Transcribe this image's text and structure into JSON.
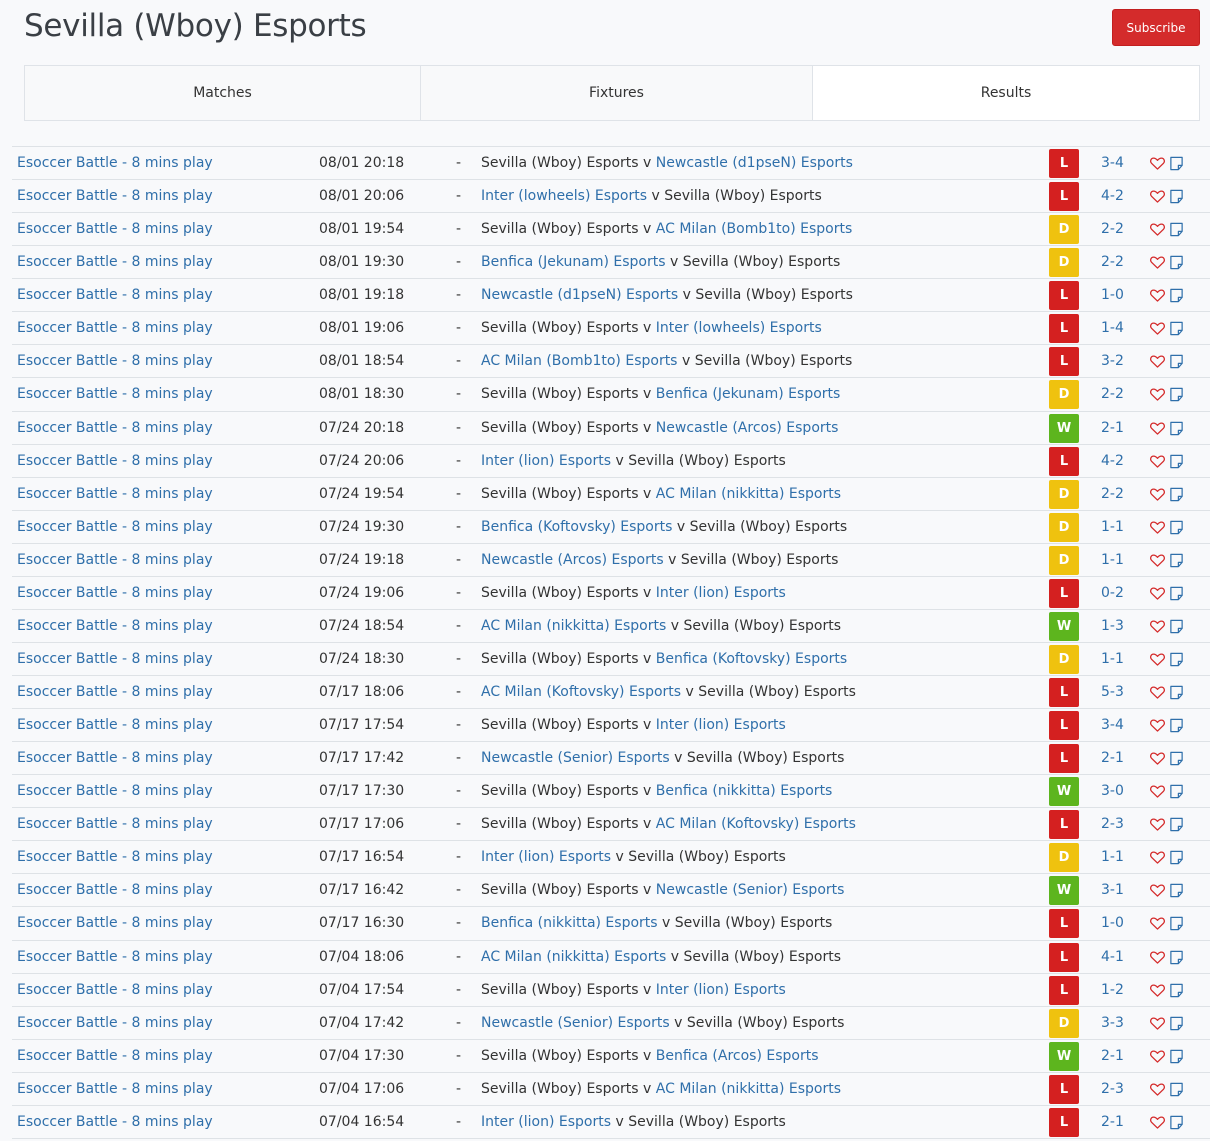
{
  "header": {
    "title": "Sevilla (Wboy) Esports",
    "subscribe_label": "Subscribe"
  },
  "tabs": [
    {
      "label": "Matches",
      "active": false
    },
    {
      "label": "Fixtures",
      "active": false
    },
    {
      "label": "Results",
      "active": true
    }
  ],
  "colors": {
    "loss": "#d42020",
    "draw": "#efc20f",
    "win": "#5db51e",
    "link": "#2f6faa",
    "accent": "#d42b2b"
  },
  "icons": {
    "favourite": "heart-outline-icon",
    "note": "note-edit-icon"
  },
  "results": [
    {
      "league": "Esoccer Battle - 8 mins play",
      "time": "08/01 20:18",
      "dash": "-",
      "home": "Sevilla (Wboy) Esports",
      "sep": "v",
      "away": "Newcastle (d1pseN) Esports",
      "home_link": false,
      "away_link": true,
      "result": "L",
      "score": "3-4"
    },
    {
      "league": "Esoccer Battle - 8 mins play",
      "time": "08/01 20:06",
      "dash": "-",
      "home": "Inter (lowheels) Esports",
      "sep": "v",
      "away": "Sevilla (Wboy) Esports",
      "home_link": true,
      "away_link": false,
      "result": "L",
      "score": "4-2"
    },
    {
      "league": "Esoccer Battle - 8 mins play",
      "time": "08/01 19:54",
      "dash": "-",
      "home": "Sevilla (Wboy) Esports",
      "sep": "v",
      "away": "AC Milan (Bomb1to) Esports",
      "home_link": false,
      "away_link": true,
      "result": "D",
      "score": "2-2"
    },
    {
      "league": "Esoccer Battle - 8 mins play",
      "time": "08/01 19:30",
      "dash": "-",
      "home": "Benfica (Jekunam) Esports",
      "sep": "v",
      "away": "Sevilla (Wboy) Esports",
      "home_link": true,
      "away_link": false,
      "result": "D",
      "score": "2-2"
    },
    {
      "league": "Esoccer Battle - 8 mins play",
      "time": "08/01 19:18",
      "dash": "-",
      "home": "Newcastle (d1pseN) Esports",
      "sep": "v",
      "away": "Sevilla (Wboy) Esports",
      "home_link": true,
      "away_link": false,
      "result": "L",
      "score": "1-0"
    },
    {
      "league": "Esoccer Battle - 8 mins play",
      "time": "08/01 19:06",
      "dash": "-",
      "home": "Sevilla (Wboy) Esports",
      "sep": "v",
      "away": "Inter (lowheels) Esports",
      "home_link": false,
      "away_link": true,
      "result": "L",
      "score": "1-4"
    },
    {
      "league": "Esoccer Battle - 8 mins play",
      "time": "08/01 18:54",
      "dash": "-",
      "home": "AC Milan (Bomb1to) Esports",
      "sep": "v",
      "away": "Sevilla (Wboy) Esports",
      "home_link": true,
      "away_link": false,
      "result": "L",
      "score": "3-2"
    },
    {
      "league": "Esoccer Battle - 8 mins play",
      "time": "08/01 18:30",
      "dash": "-",
      "home": "Sevilla (Wboy) Esports",
      "sep": "v",
      "away": "Benfica (Jekunam) Esports",
      "home_link": false,
      "away_link": true,
      "result": "D",
      "score": "2-2"
    },
    {
      "league": "Esoccer Battle - 8 mins play",
      "time": "07/24 20:18",
      "dash": "-",
      "home": "Sevilla (Wboy) Esports",
      "sep": "v",
      "away": "Newcastle (Arcos) Esports",
      "home_link": false,
      "away_link": true,
      "result": "W",
      "score": "2-1"
    },
    {
      "league": "Esoccer Battle - 8 mins play",
      "time": "07/24 20:06",
      "dash": "-",
      "home": "Inter (lion) Esports",
      "sep": "v",
      "away": "Sevilla (Wboy) Esports",
      "home_link": true,
      "away_link": false,
      "result": "L",
      "score": "4-2"
    },
    {
      "league": "Esoccer Battle - 8 mins play",
      "time": "07/24 19:54",
      "dash": "-",
      "home": "Sevilla (Wboy) Esports",
      "sep": "v",
      "away": "AC Milan (nikkitta) Esports",
      "home_link": false,
      "away_link": true,
      "result": "D",
      "score": "2-2"
    },
    {
      "league": "Esoccer Battle - 8 mins play",
      "time": "07/24 19:30",
      "dash": "-",
      "home": "Benfica (Koftovsky) Esports",
      "sep": "v",
      "away": "Sevilla (Wboy) Esports",
      "home_link": true,
      "away_link": false,
      "result": "D",
      "score": "1-1"
    },
    {
      "league": "Esoccer Battle - 8 mins play",
      "time": "07/24 19:18",
      "dash": "-",
      "home": "Newcastle (Arcos) Esports",
      "sep": "v",
      "away": "Sevilla (Wboy) Esports",
      "home_link": true,
      "away_link": false,
      "result": "D",
      "score": "1-1"
    },
    {
      "league": "Esoccer Battle - 8 mins play",
      "time": "07/24 19:06",
      "dash": "-",
      "home": "Sevilla (Wboy) Esports",
      "sep": "v",
      "away": "Inter (lion) Esports",
      "home_link": false,
      "away_link": true,
      "result": "L",
      "score": "0-2"
    },
    {
      "league": "Esoccer Battle - 8 mins play",
      "time": "07/24 18:54",
      "dash": "-",
      "home": "AC Milan (nikkitta) Esports",
      "sep": "v",
      "away": "Sevilla (Wboy) Esports",
      "home_link": true,
      "away_link": false,
      "result": "W",
      "score": "1-3"
    },
    {
      "league": "Esoccer Battle - 8 mins play",
      "time": "07/24 18:30",
      "dash": "-",
      "home": "Sevilla (Wboy) Esports",
      "sep": "v",
      "away": "Benfica (Koftovsky) Esports",
      "home_link": false,
      "away_link": true,
      "result": "D",
      "score": "1-1"
    },
    {
      "league": "Esoccer Battle - 8 mins play",
      "time": "07/17 18:06",
      "dash": "-",
      "home": "AC Milan (Koftovsky) Esports",
      "sep": "v",
      "away": "Sevilla (Wboy) Esports",
      "home_link": true,
      "away_link": false,
      "result": "L",
      "score": "5-3"
    },
    {
      "league": "Esoccer Battle - 8 mins play",
      "time": "07/17 17:54",
      "dash": "-",
      "home": "Sevilla (Wboy) Esports",
      "sep": "v",
      "away": "Inter (lion) Esports",
      "home_link": false,
      "away_link": true,
      "result": "L",
      "score": "3-4"
    },
    {
      "league": "Esoccer Battle - 8 mins play",
      "time": "07/17 17:42",
      "dash": "-",
      "home": "Newcastle (Senior) Esports",
      "sep": "v",
      "away": "Sevilla (Wboy) Esports",
      "home_link": true,
      "away_link": false,
      "result": "L",
      "score": "2-1"
    },
    {
      "league": "Esoccer Battle - 8 mins play",
      "time": "07/17 17:30",
      "dash": "-",
      "home": "Sevilla (Wboy) Esports",
      "sep": "v",
      "away": "Benfica (nikkitta) Esports",
      "home_link": false,
      "away_link": true,
      "result": "W",
      "score": "3-0"
    },
    {
      "league": "Esoccer Battle - 8 mins play",
      "time": "07/17 17:06",
      "dash": "-",
      "home": "Sevilla (Wboy) Esports",
      "sep": "v",
      "away": "AC Milan (Koftovsky) Esports",
      "home_link": false,
      "away_link": true,
      "result": "L",
      "score": "2-3"
    },
    {
      "league": "Esoccer Battle - 8 mins play",
      "time": "07/17 16:54",
      "dash": "-",
      "home": "Inter (lion) Esports",
      "sep": "v",
      "away": "Sevilla (Wboy) Esports",
      "home_link": true,
      "away_link": false,
      "result": "D",
      "score": "1-1"
    },
    {
      "league": "Esoccer Battle - 8 mins play",
      "time": "07/17 16:42",
      "dash": "-",
      "home": "Sevilla (Wboy) Esports",
      "sep": "v",
      "away": "Newcastle (Senior) Esports",
      "home_link": false,
      "away_link": true,
      "result": "W",
      "score": "3-1"
    },
    {
      "league": "Esoccer Battle - 8 mins play",
      "time": "07/17 16:30",
      "dash": "-",
      "home": "Benfica (nikkitta) Esports",
      "sep": "v",
      "away": "Sevilla (Wboy) Esports",
      "home_link": true,
      "away_link": false,
      "result": "L",
      "score": "1-0"
    },
    {
      "league": "Esoccer Battle - 8 mins play",
      "time": "07/04 18:06",
      "dash": "-",
      "home": "AC Milan (nikkitta) Esports",
      "sep": "v",
      "away": "Sevilla (Wboy) Esports",
      "home_link": true,
      "away_link": false,
      "result": "L",
      "score": "4-1"
    },
    {
      "league": "Esoccer Battle - 8 mins play",
      "time": "07/04 17:54",
      "dash": "-",
      "home": "Sevilla (Wboy) Esports",
      "sep": "v",
      "away": "Inter (lion) Esports",
      "home_link": false,
      "away_link": true,
      "result": "L",
      "score": "1-2"
    },
    {
      "league": "Esoccer Battle - 8 mins play",
      "time": "07/04 17:42",
      "dash": "-",
      "home": "Newcastle (Senior) Esports",
      "sep": "v",
      "away": "Sevilla (Wboy) Esports",
      "home_link": true,
      "away_link": false,
      "result": "D",
      "score": "3-3"
    },
    {
      "league": "Esoccer Battle - 8 mins play",
      "time": "07/04 17:30",
      "dash": "-",
      "home": "Sevilla (Wboy) Esports",
      "sep": "v",
      "away": "Benfica (Arcos) Esports",
      "home_link": false,
      "away_link": true,
      "result": "W",
      "score": "2-1"
    },
    {
      "league": "Esoccer Battle - 8 mins play",
      "time": "07/04 17:06",
      "dash": "-",
      "home": "Sevilla (Wboy) Esports",
      "sep": "v",
      "away": "AC Milan (nikkitta) Esports",
      "home_link": false,
      "away_link": true,
      "result": "L",
      "score": "2-3"
    },
    {
      "league": "Esoccer Battle - 8 mins play",
      "time": "07/04 16:54",
      "dash": "-",
      "home": "Inter (lion) Esports",
      "sep": "v",
      "away": "Sevilla (Wboy) Esports",
      "home_link": true,
      "away_link": false,
      "result": "L",
      "score": "2-1"
    }
  ]
}
